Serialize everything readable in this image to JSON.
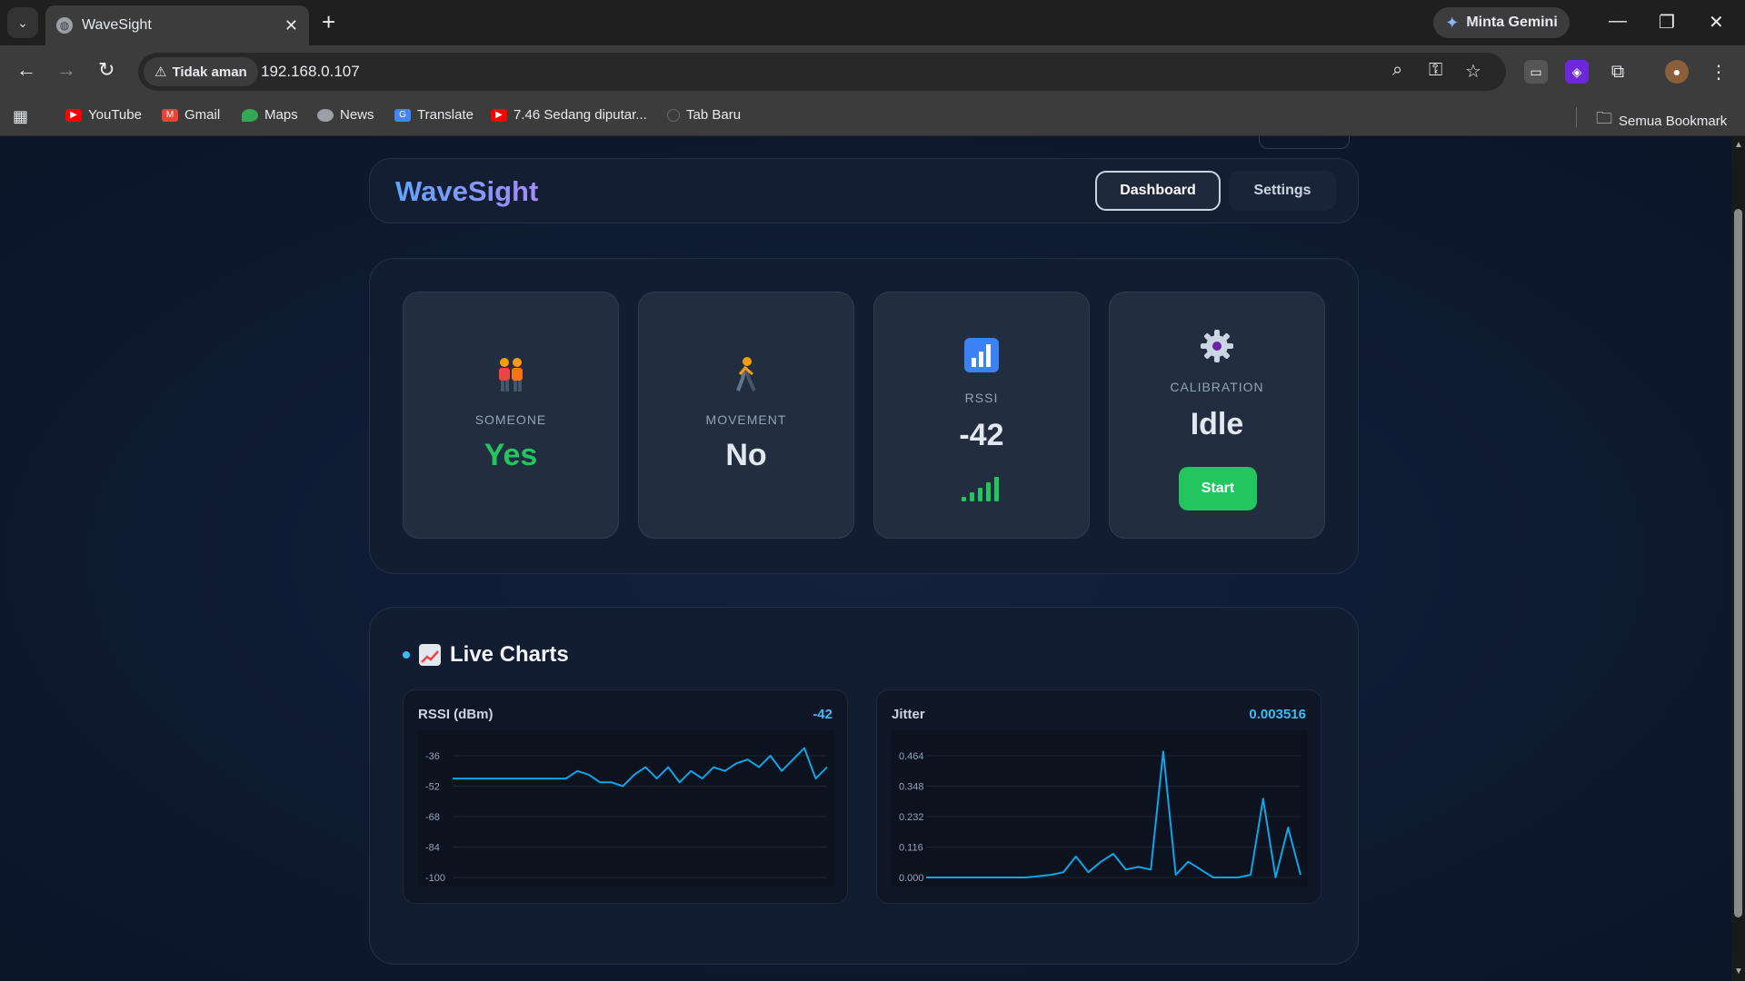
{
  "browser": {
    "tab_title": "WaveSight",
    "gemini_label": "Minta Gemini",
    "security_label": "Tidak aman",
    "url": "192.168.0.107",
    "bookmarks": [
      "YouTube",
      "Gmail",
      "Maps",
      "News",
      "Translate",
      "7.46 Sedang diputar...",
      "Tab Baru"
    ],
    "all_bookmarks": "Semua Bookmark"
  },
  "app": {
    "brand": "WaveSight",
    "nav": {
      "dashboard": "Dashboard",
      "settings": "Settings"
    }
  },
  "status": {
    "someone": {
      "label": "SOMEONE",
      "value": "Yes",
      "icon": "people-icon"
    },
    "movement": {
      "label": "MOVEMENT",
      "value": "No",
      "icon": "walking-person-icon"
    },
    "rssi": {
      "label": "RSSI",
      "value": "-42",
      "icon": "bar-chart-icon",
      "signal_bars": 5
    },
    "calibration": {
      "label": "CALIBRATION",
      "value": "Idle",
      "button": "Start",
      "icon": "gear-icon"
    }
  },
  "charts_section": {
    "title": "Live Charts"
  },
  "colors": {
    "accent": "#38bdf8",
    "success": "#22c55e",
    "line": "#0ea5e9"
  },
  "chart_data": [
    {
      "type": "line",
      "title": "RSSI (dBm)",
      "latest": "-42",
      "yticks": [
        "-36",
        "-52",
        "-68",
        "-84",
        "-100"
      ],
      "ylim": [
        -100,
        -36
      ],
      "grid": true,
      "series": [
        {
          "values": [
            -48,
            -48,
            -48,
            -48,
            -48,
            -48,
            -48,
            -48,
            -48,
            -48,
            -48,
            -44,
            -46,
            -50,
            -50,
            -52,
            -46,
            -42,
            -48,
            -42,
            -50,
            -44,
            -48,
            -42,
            -44,
            -40,
            -38,
            -42,
            -36,
            -44,
            -38,
            -32,
            -48,
            -42
          ]
        }
      ]
    },
    {
      "type": "line",
      "title": "Jitter",
      "latest": "0.003516",
      "yticks": [
        "0.464",
        "0.348",
        "0.232",
        "0.116",
        "0.000"
      ],
      "ylim": [
        0,
        0.464
      ],
      "grid": true,
      "series": [
        {
          "values": [
            0,
            0,
            0,
            0,
            0,
            0,
            0,
            0,
            0,
            0.005,
            0.01,
            0.02,
            0.08,
            0.02,
            0.06,
            0.09,
            0.03,
            0.04,
            0.03,
            0.48,
            0.01,
            0.06,
            0.03,
            0,
            0,
            0,
            0.01,
            0.3,
            0,
            0.19,
            0.01
          ]
        }
      ]
    }
  ]
}
